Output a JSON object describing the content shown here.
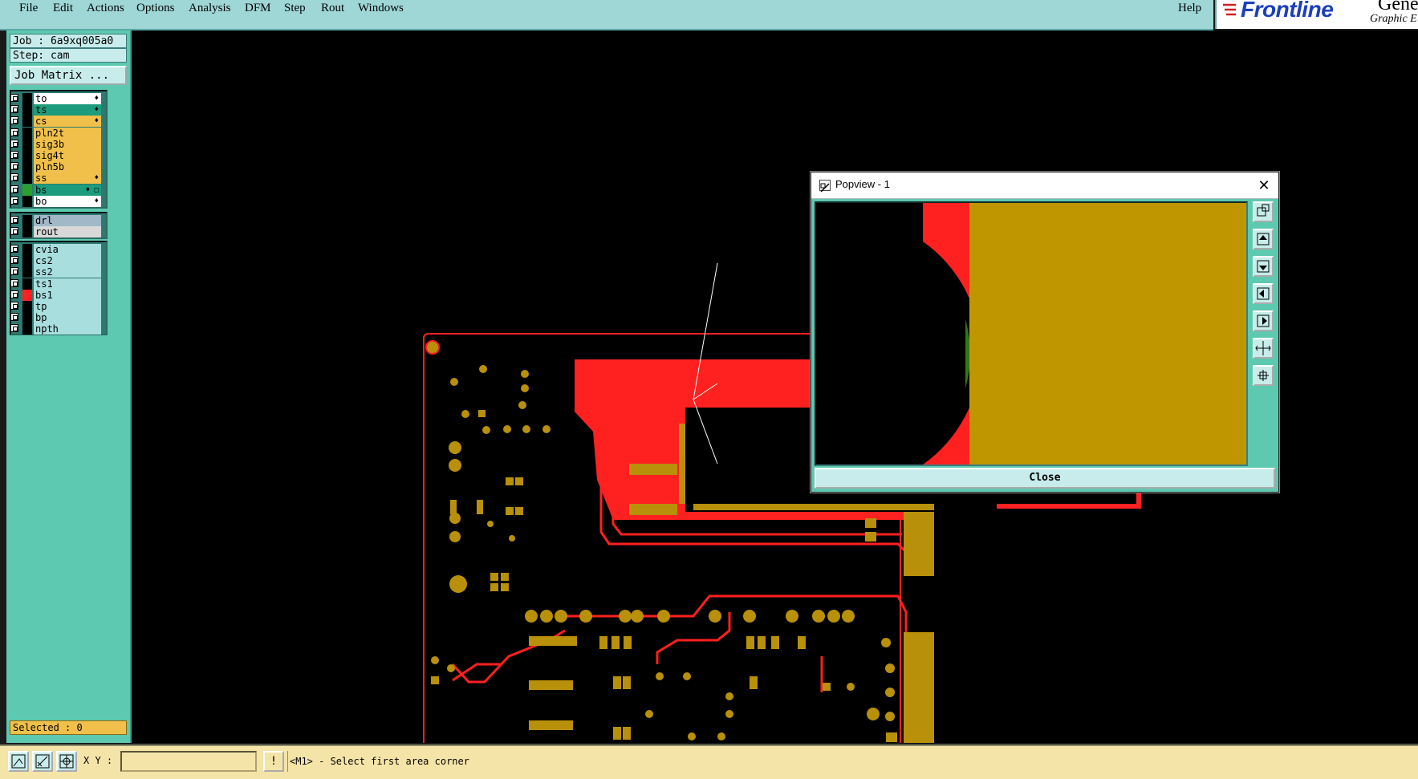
{
  "menu": {
    "items": [
      "File",
      "Edit",
      "Actions",
      "Options",
      "Analysis",
      "DFM",
      "Step",
      "Rout",
      "Windows"
    ],
    "help": "Help"
  },
  "brand": {
    "name": "Frontline",
    "product": "Genesis",
    "subtitle": "Graphic E"
  },
  "left_panel": {
    "job": "Job : 6a9xq005a0",
    "step": "Step: cam",
    "job_matrix": "Job Matrix ...",
    "selected": "Selected : 0"
  },
  "layers": [
    {
      "name": "to",
      "color": "#ffffff",
      "swatch": "#000000",
      "flag": "♦"
    },
    {
      "name": "ts",
      "color": "#1c9c7c",
      "swatch": "#000000",
      "flag": "♦"
    },
    {
      "name": "cs",
      "color": "#f0c04a",
      "swatch": "#000000",
      "flag": "♦"
    },
    {
      "name": "pln2t",
      "color": "#f0c04a",
      "swatch": "#000000",
      "flag": ""
    },
    {
      "name": "sig3b",
      "color": "#f0c04a",
      "swatch": "#000000",
      "flag": ""
    },
    {
      "name": "sig4t",
      "color": "#f0c04a",
      "swatch": "#000000",
      "flag": ""
    },
    {
      "name": "pln5b",
      "color": "#f0c04a",
      "swatch": "#000000",
      "flag": ""
    },
    {
      "name": "ss",
      "color": "#f0c04a",
      "swatch": "#000000",
      "flag": "♦"
    },
    {
      "name": "bs",
      "color": "#1c9c7c",
      "swatch": "#2ca02c",
      "flag": "♦ □"
    },
    {
      "name": "bo",
      "color": "#ffffff",
      "swatch": "#000000",
      "flag": "♦"
    },
    {
      "name": "drl",
      "color": "#a0b8c8",
      "swatch": "#000000",
      "flag": ""
    },
    {
      "name": "rout",
      "color": "#d8d8d8",
      "swatch": "#000000",
      "flag": ""
    },
    {
      "name": "cvia",
      "color": "#a8dede",
      "swatch": "#000000",
      "flag": ""
    },
    {
      "name": "cs2",
      "color": "#a8dede",
      "swatch": "#000000",
      "flag": ""
    },
    {
      "name": "ss2",
      "color": "#a8dede",
      "swatch": "#000000",
      "flag": ""
    },
    {
      "name": "ts1",
      "color": "#a8dede",
      "swatch": "#000000",
      "flag": ""
    },
    {
      "name": "bs1",
      "color": "#a8dede",
      "swatch": "#ff2020",
      "flag": ""
    },
    {
      "name": "tp",
      "color": "#a8dede",
      "swatch": "#000000",
      "flag": ""
    },
    {
      "name": "bp",
      "color": "#a8dede",
      "swatch": "#000000",
      "flag": ""
    },
    {
      "name": "npth",
      "color": "#a8dede",
      "swatch": "#000000",
      "flag": ""
    }
  ],
  "status": {
    "xy_label": "X Y :",
    "xy_value": "",
    "bang": "!",
    "prompt": "<M1> - Select first area corner"
  },
  "popview": {
    "title": "Popview - 1",
    "close_button": "Close",
    "tools": [
      "zoom-window-icon",
      "pan-up-icon",
      "pan-down-icon",
      "pan-left-icon",
      "pan-right-icon",
      "zoom-in-icon",
      "zoom-out-icon"
    ]
  },
  "colors": {
    "copper": "#b8900a",
    "copper_fill": "#c09600",
    "red_layer": "#ff2020",
    "green_layer": "#2f7a10",
    "panel": "#5cc9b0"
  }
}
